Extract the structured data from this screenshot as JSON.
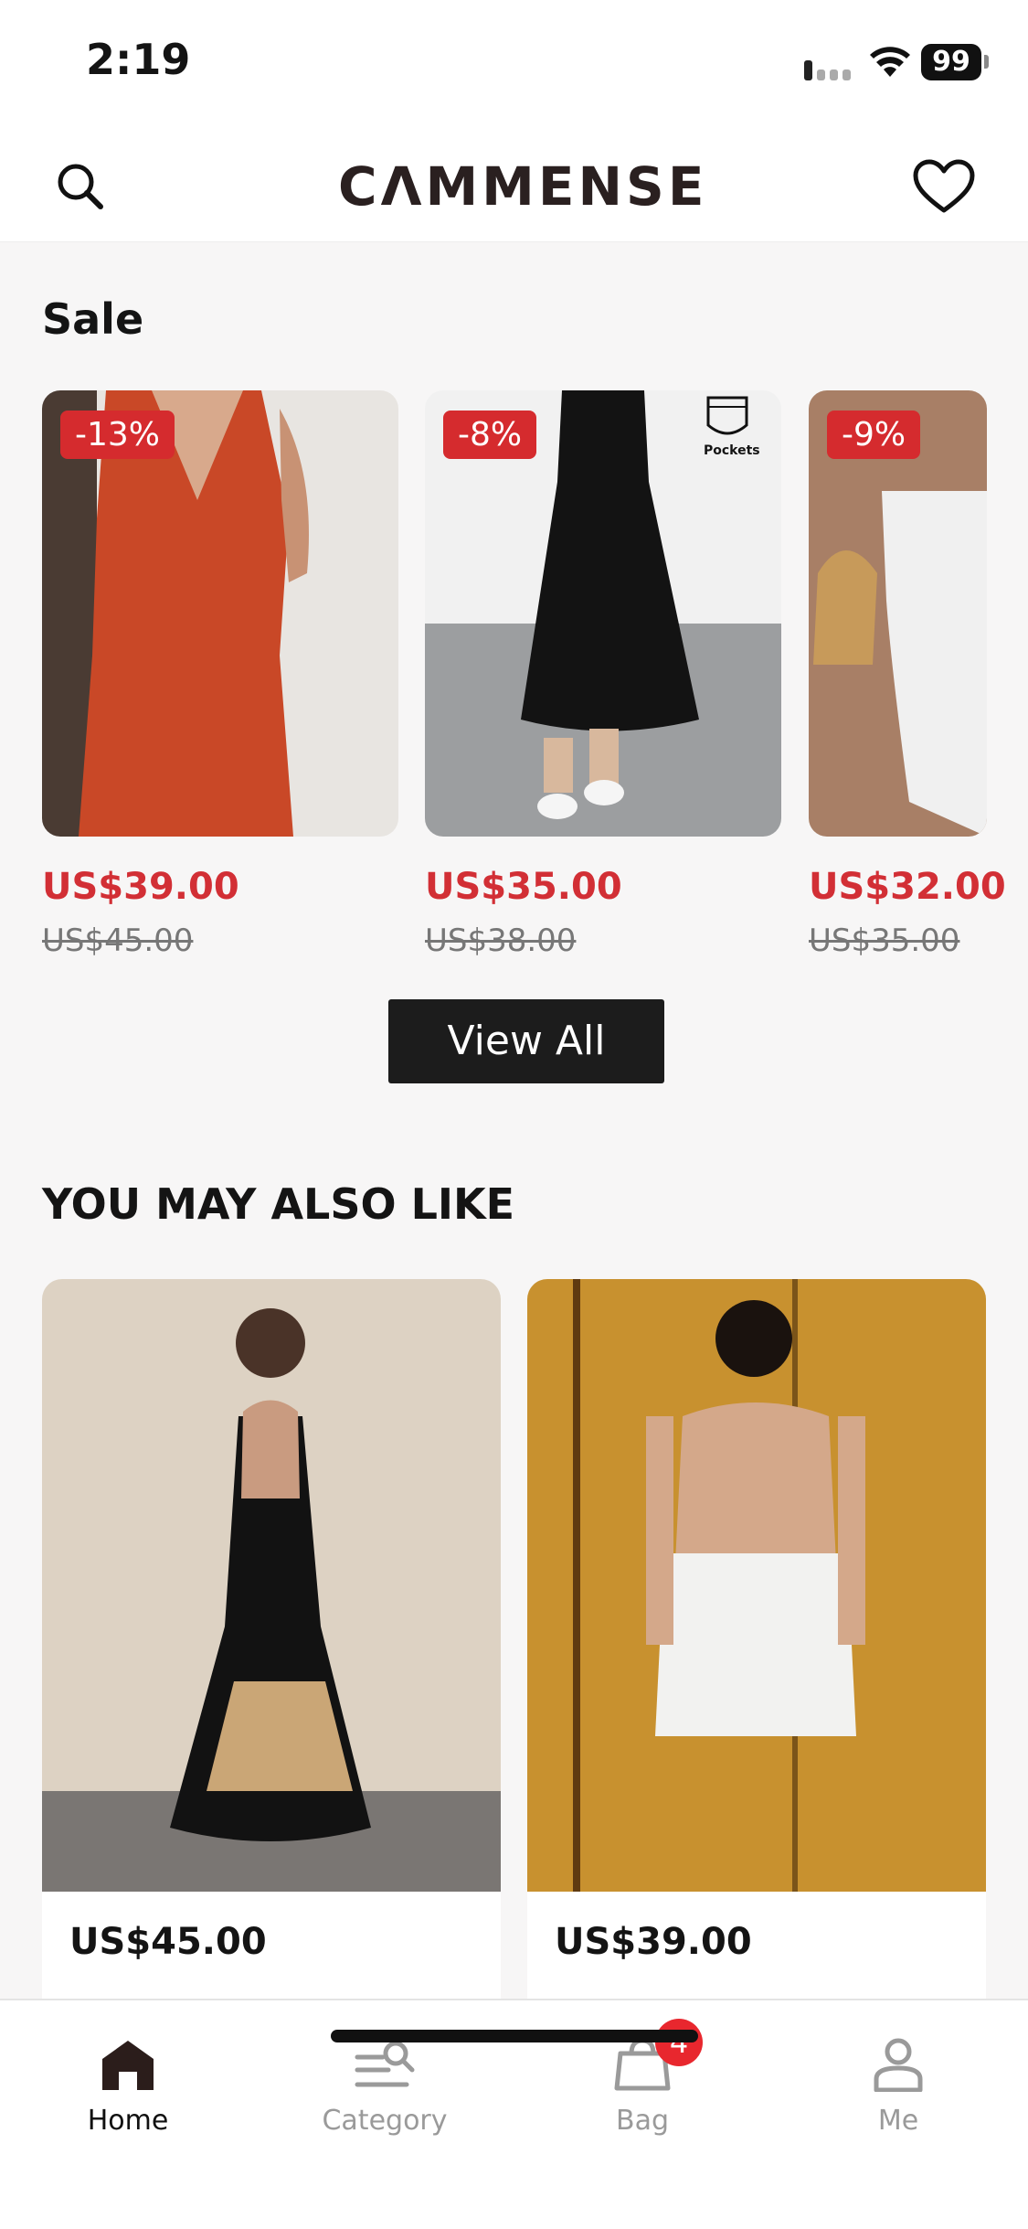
{
  "status_bar": {
    "time": "2:19",
    "battery": "99"
  },
  "header": {
    "logo": "CΛMMENSE"
  },
  "sale": {
    "title": "Sale",
    "items": [
      {
        "discount": "-13%",
        "price": "US$39.00",
        "original_price": "US$45.00"
      },
      {
        "discount": "-8%",
        "price": "US$35.00",
        "original_price": "US$38.00",
        "tag": "Pockets"
      },
      {
        "discount": "-9%",
        "price": "US$32.00",
        "original_price": "US$35.00"
      }
    ],
    "view_all": "View All"
  },
  "recommend": {
    "title": "YOU MAY ALSO LIKE",
    "items": [
      {
        "price": "US$45.00"
      },
      {
        "price": "US$39.00"
      }
    ]
  },
  "tabbar": {
    "items": [
      {
        "label": "Home",
        "icon": "home-icon",
        "active": true
      },
      {
        "label": "Category",
        "icon": "category-icon"
      },
      {
        "label": "Bag",
        "icon": "bag-icon",
        "badge": "4"
      },
      {
        "label": "Me",
        "icon": "person-icon"
      }
    ]
  },
  "colors": {
    "sale_red": "#d22f35",
    "badge_red": "#d52b2e",
    "dark": "#1c1c1c"
  }
}
